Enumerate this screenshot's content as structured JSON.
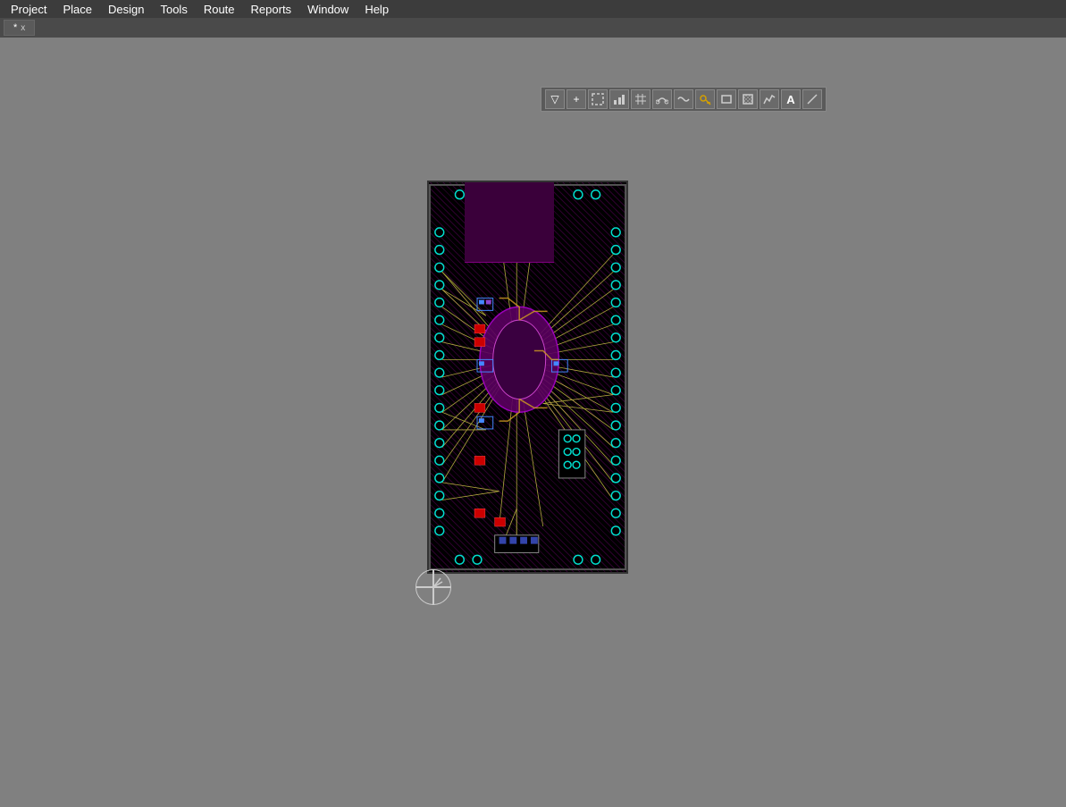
{
  "menubar": {
    "items": [
      {
        "id": "project",
        "label": "Project"
      },
      {
        "id": "place",
        "label": "Place"
      },
      {
        "id": "design",
        "label": "Design"
      },
      {
        "id": "tools",
        "label": "Tools"
      },
      {
        "id": "route",
        "label": "Route"
      },
      {
        "id": "reports",
        "label": "Reports"
      },
      {
        "id": "window",
        "label": "Window"
      },
      {
        "id": "help",
        "label": "Help"
      }
    ]
  },
  "tab": {
    "label": "*",
    "close": "x"
  },
  "toolbar": {
    "buttons": [
      {
        "id": "filter",
        "icon": "▽",
        "label": "filter"
      },
      {
        "id": "add",
        "icon": "+",
        "label": "add"
      },
      {
        "id": "rect-select",
        "icon": "⬜",
        "label": "rectangle-select"
      },
      {
        "id": "chart",
        "icon": "📊",
        "label": "chart"
      },
      {
        "id": "grid",
        "icon": "⊞",
        "label": "grid"
      },
      {
        "id": "route1",
        "icon": "⌒",
        "label": "route1"
      },
      {
        "id": "route2",
        "icon": "〜",
        "label": "route2"
      },
      {
        "id": "key",
        "icon": "🔑",
        "label": "key"
      },
      {
        "id": "shape",
        "icon": "▭",
        "label": "shape"
      },
      {
        "id": "crop",
        "icon": "⊡",
        "label": "crop"
      },
      {
        "id": "stats",
        "icon": "📈",
        "label": "stats"
      },
      {
        "id": "text",
        "icon": "A",
        "label": "text"
      },
      {
        "id": "line",
        "icon": "╱",
        "label": "line"
      }
    ]
  },
  "colors": {
    "bg": "#808080",
    "menubar": "#3c3c3c",
    "pcb_bg": "#000000",
    "hatch": "#b000b0",
    "via_ring": "#00e0d0",
    "ratsnest": "#d4c84a",
    "component_red": "#cc0000",
    "component_blue": "#2244cc",
    "component_purple": "#8800aa"
  }
}
